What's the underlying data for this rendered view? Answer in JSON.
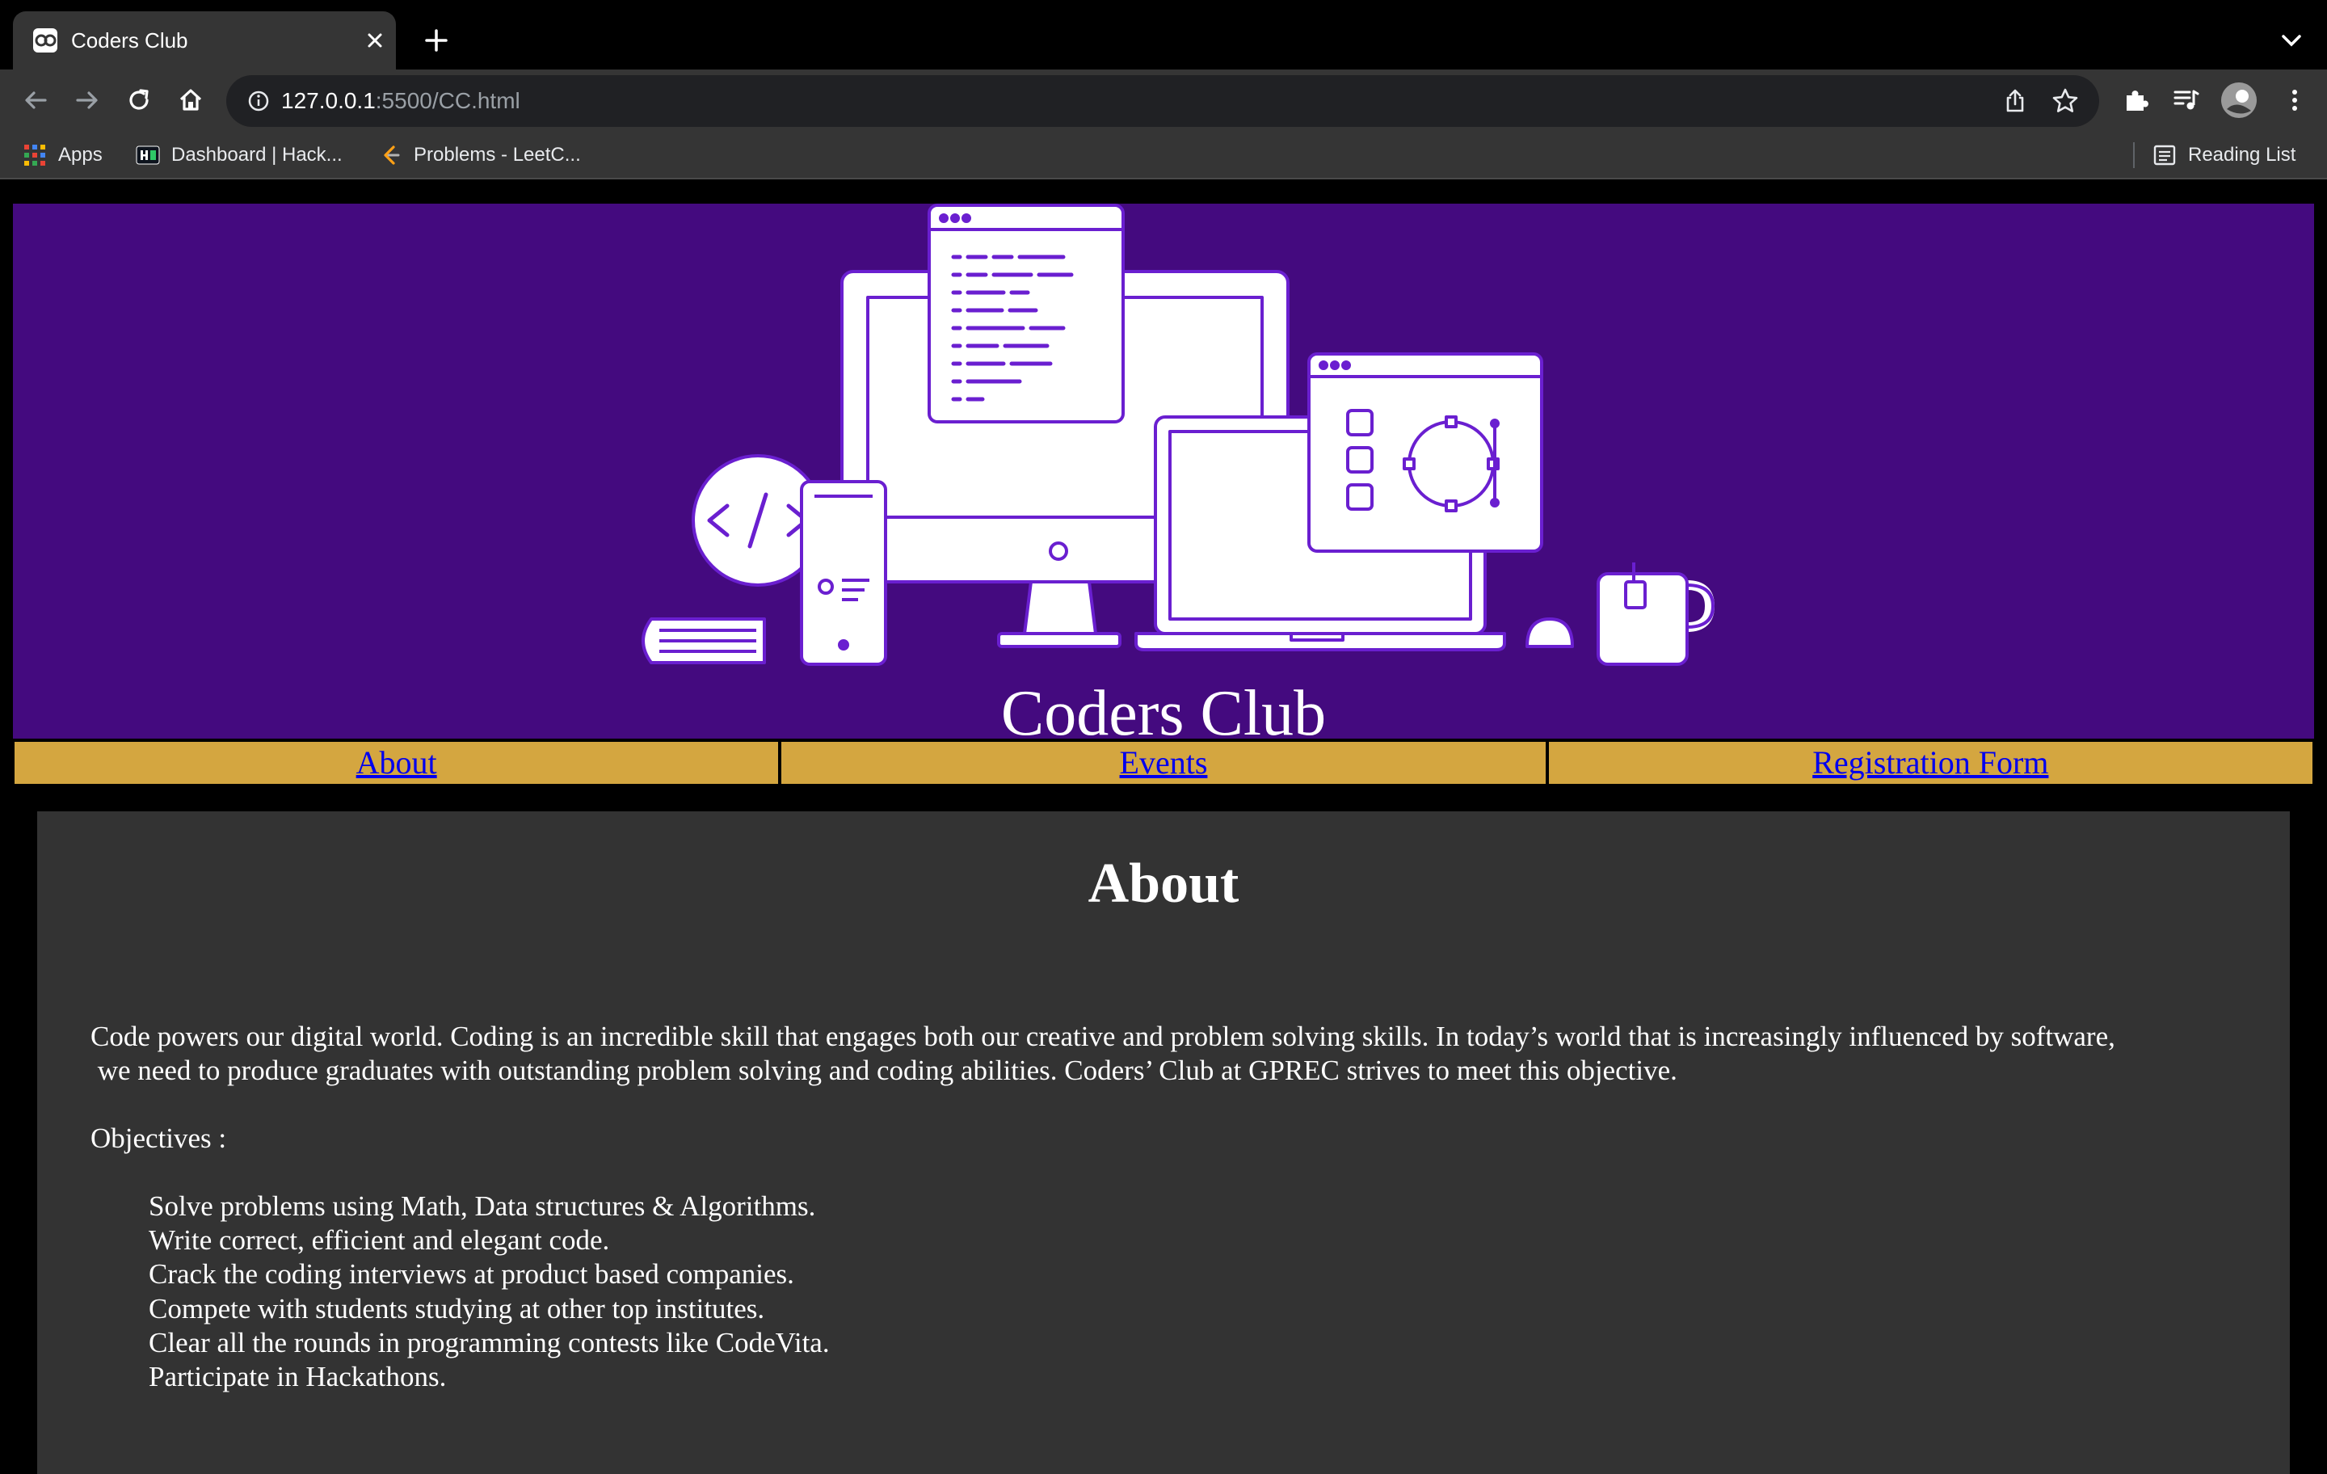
{
  "browser": {
    "tab_title": "Coders Club",
    "url_host": "127.0.0.1",
    "url_rest": ":5500/CC.html",
    "bookmarks": [
      {
        "label": "Apps",
        "icon": "apps-grid-icon"
      },
      {
        "label": "Dashboard | Hack...",
        "icon": "hackerrank-icon"
      },
      {
        "label": "Problems - LeetC...",
        "icon": "leetcode-icon"
      }
    ],
    "reading_list": "Reading List"
  },
  "page": {
    "site_title": "Coders Club",
    "nav": [
      "About",
      "Events",
      "Registration Form"
    ],
    "about": {
      "heading": "About",
      "para_line1": "Code powers our digital world. Coding is an incredible skill that engages both our creative and problem solving skills. In today’s world that is increasingly influenced by software,",
      "para_line2": " we need to produce graduates with outstanding problem solving and coding abilities. Coders’ Club at GPREC strives to meet this objective.",
      "objectives_label": "Objectives :",
      "objectives": [
        "Solve problems using Math, Data structures & Algorithms.",
        "Write correct, efficient and elegant code.",
        "Crack the coding interviews at product based companies.",
        "Compete with students studying at other top institutes.",
        "Clear all the rounds in programming contests like CodeVita.",
        "Participate in Hackathons."
      ]
    }
  },
  "colors": {
    "hero_bg": "#440a7f",
    "illustration_stroke": "#6a1fd0",
    "nav_bg": "#d4a640",
    "link": "#0000ee",
    "content_bg": "#333333"
  }
}
